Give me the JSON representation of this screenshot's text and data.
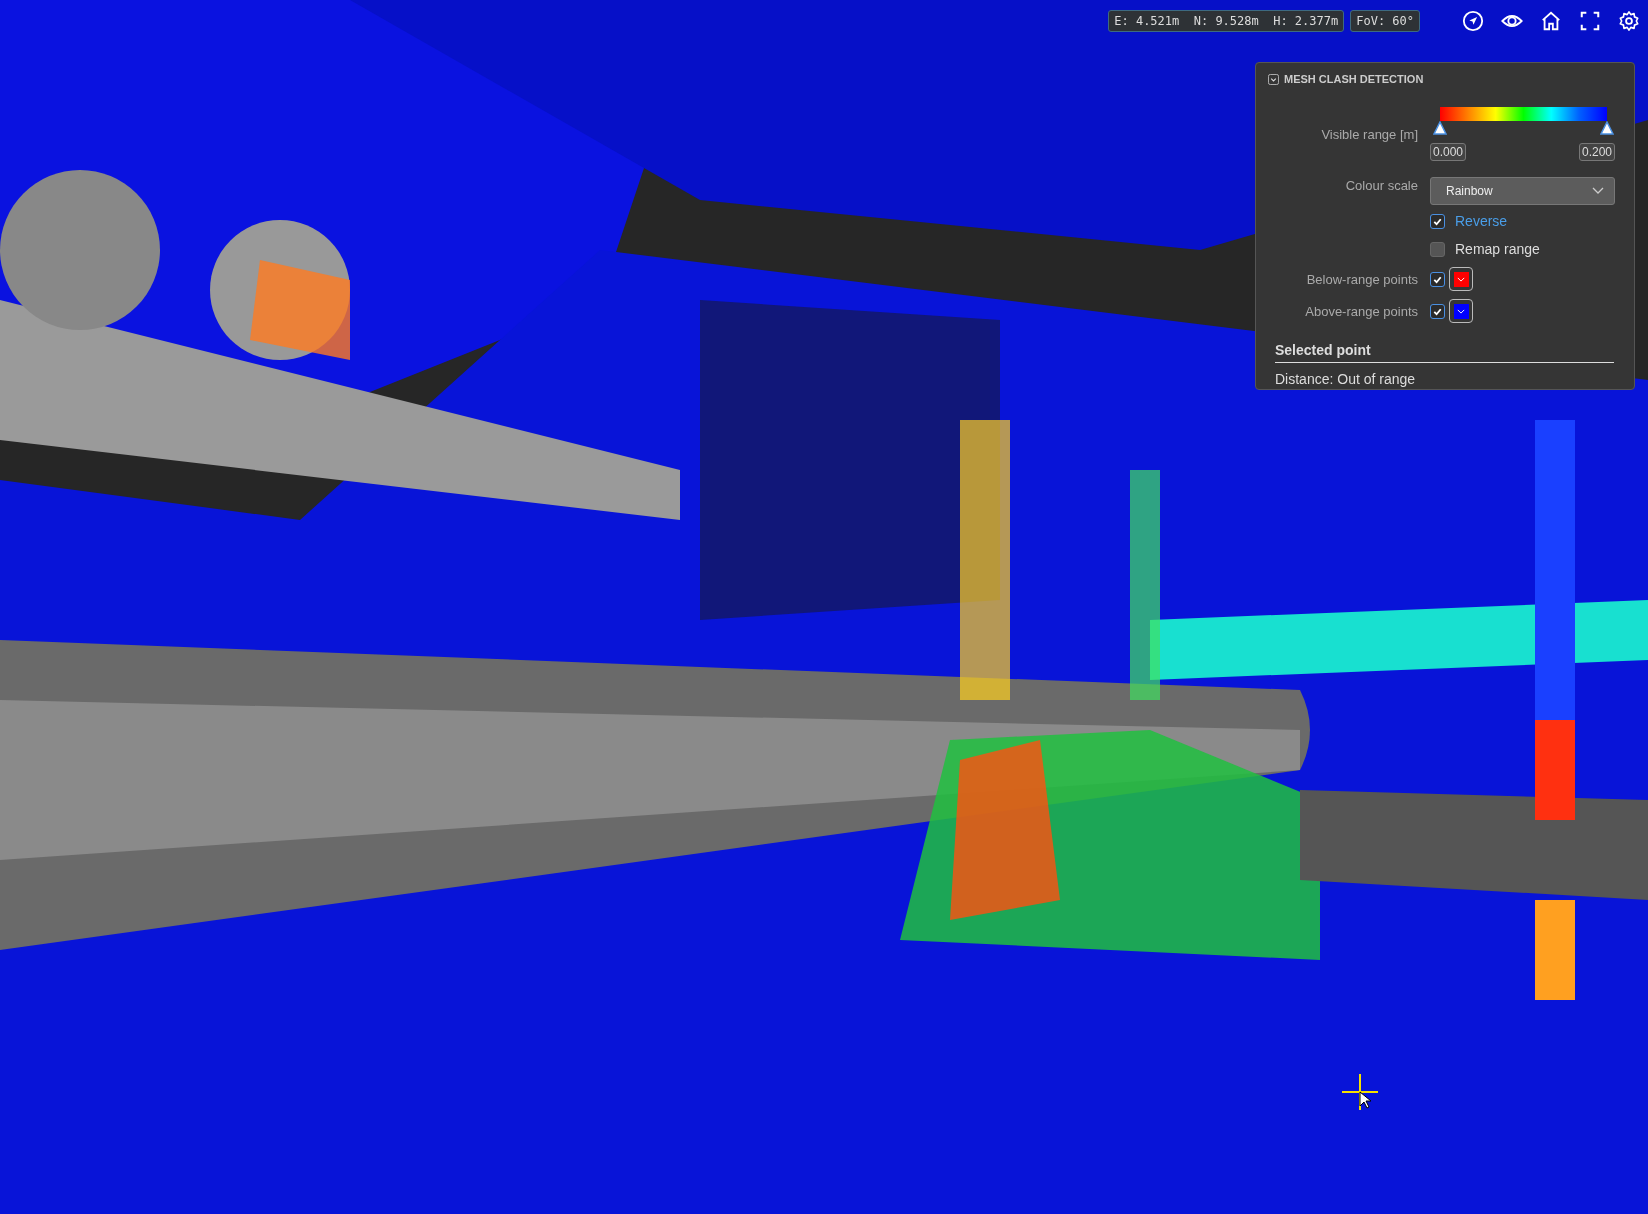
{
  "coordinates": {
    "readout": "E: 4.521m  N: 9.528m  H: 2.377m",
    "fov": "FoV: 60°"
  },
  "toolbar": [
    {
      "kind": "navigate"
    },
    {
      "kind": "eye"
    },
    {
      "kind": "home"
    },
    {
      "kind": "fullscreen"
    },
    {
      "kind": "settings"
    }
  ],
  "panel": {
    "title": "MESH CLASH DETECTION",
    "expanded": true,
    "visible_range": {
      "label": "Visible range [m]",
      "thumbs": [
        {
          "level": 0
        },
        {
          "level": 1
        }
      ],
      "min": "0.000",
      "max": "0.200"
    },
    "colour_scale": {
      "label": "Colour scale",
      "value": "Rainbow"
    },
    "options": [
      {
        "label": "Reverse",
        "checked": true
      },
      {
        "label": "Remap range",
        "checked": false
      }
    ],
    "range_points": [
      {
        "label": "Below-range points",
        "checked": true,
        "color": "#ff0000"
      },
      {
        "label": "Above-range points",
        "checked": true,
        "color": "#0000ff"
      }
    ],
    "selected_point": {
      "heading": "Selected point",
      "distance": "Distance: Out of range"
    }
  }
}
